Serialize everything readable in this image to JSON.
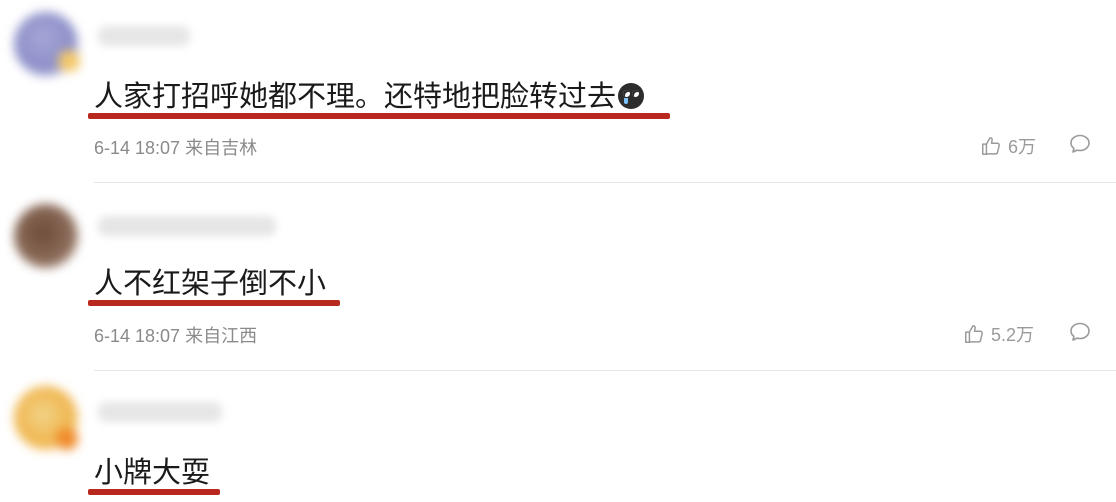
{
  "comments": [
    {
      "avatar_icon": "avatar-icon",
      "text": "人家打招呼她都不理。还特地把脸转过去",
      "emoji_icon": "crying-face-icon",
      "time": "6-14 18:07",
      "location": "来自吉林",
      "likes": "6万"
    },
    {
      "avatar_icon": "avatar-icon",
      "text": "人不红架子倒不小",
      "time": "6-14 18:07",
      "location": "来自江西",
      "likes": "5.2万"
    },
    {
      "avatar_icon": "avatar-icon",
      "text": "小牌大耍"
    }
  ],
  "colors": {
    "underline": "#b8281e",
    "meta_text": "#8a8a8a",
    "divider": "#e7e7e7"
  },
  "icons": {
    "like": "thumbs-up-icon",
    "reply": "comment-bubble-icon"
  }
}
